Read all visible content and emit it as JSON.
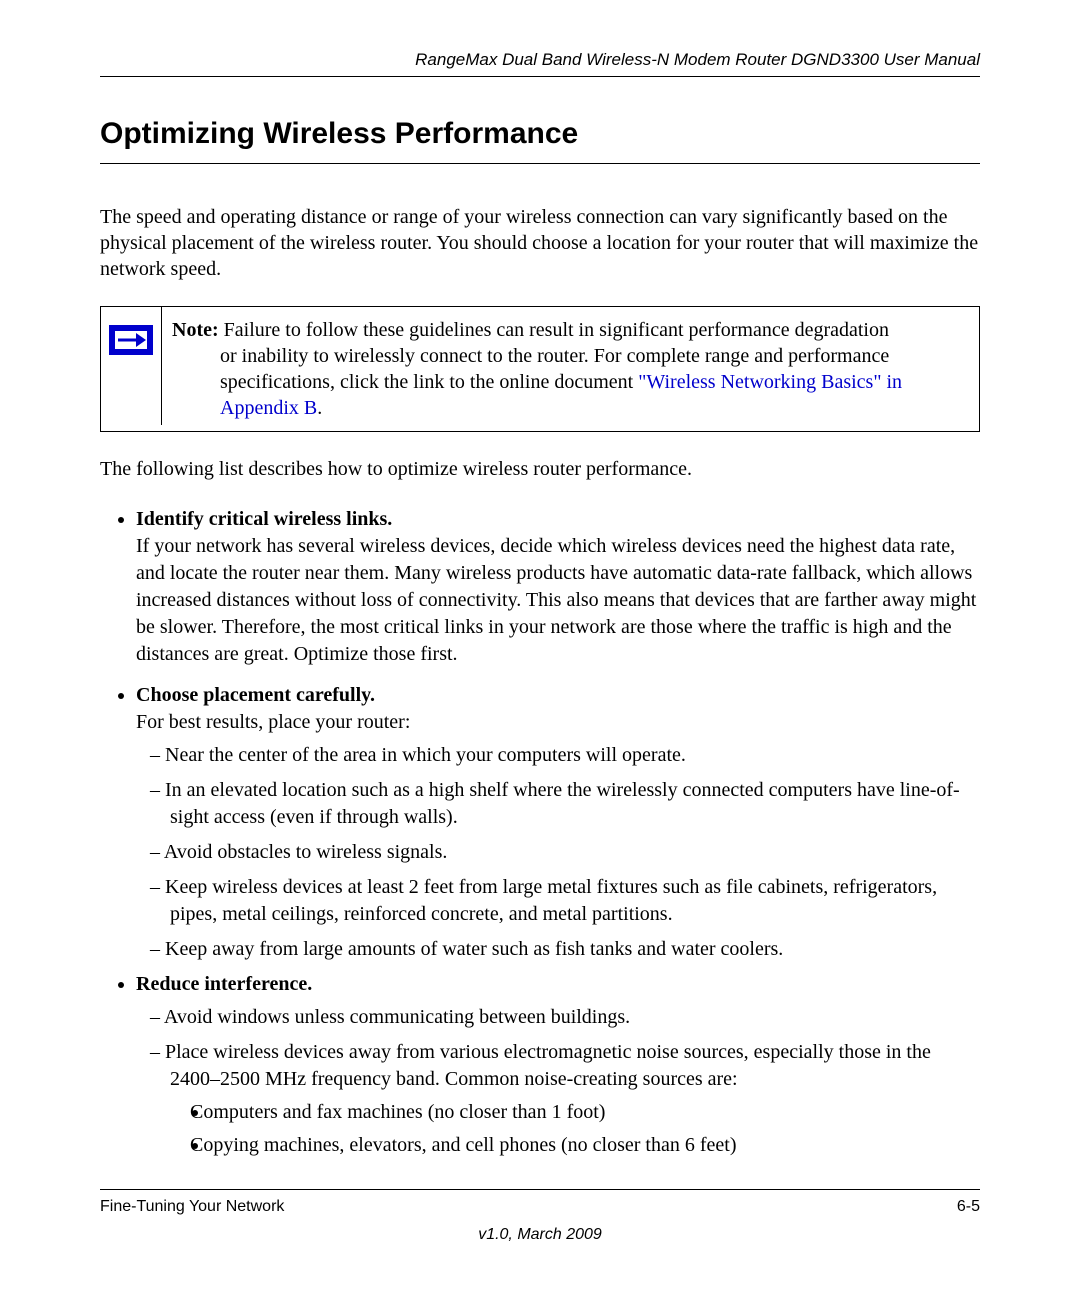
{
  "header": {
    "doc_title": "RangeMax Dual Band Wireless-N Modem Router DGND3300 User Manual"
  },
  "title": "Optimizing Wireless Performance",
  "intro": "The speed and operating distance or range of your wireless connection can vary significantly based on the physical placement of the wireless router. You should choose a location for your router that will maximize the network speed.",
  "note": {
    "label": "Note:",
    "text_before_link": " Failure to follow these guidelines can result in significant performance degradation or inability to wirelessly connect to the router. For complete range and performance specifications, click the link to the online document ",
    "link_text": "\"Wireless Networking Basics\" in Appendix B",
    "after_link": "."
  },
  "lead": "The following list describes how to optimize wireless router performance.",
  "b1": {
    "title": "Identify critical wireless links.",
    "body": "If your network has several wireless devices, decide which wireless devices need the highest data rate, and locate the router near them. Many wireless products have automatic data-rate fallback, which allows increased distances without loss of connectivity. This also means that devices that are farther away might be slower. Therefore, the most critical links in your network are those where the traffic is high and the distances are great. Optimize those first."
  },
  "b2": {
    "title": "Choose placement carefully.",
    "body": "For best results, place your router:",
    "d1": "Near the center of the area in which your computers will operate.",
    "d2": "In an elevated location such as a high shelf where the wirelessly connected computers have line-of-sight access (even if through walls).",
    "d3": "Avoid obstacles to wireless signals.",
    "d4": "Keep wireless devices at least 2 feet from large metal fixtures such as file cabinets, refrigerators, pipes, metal ceilings, reinforced concrete, and metal partitions.",
    "d5": "Keep away from large amounts of water such as fish tanks and water coolers."
  },
  "b3": {
    "title": "Reduce interference.",
    "d1": "Avoid windows unless communicating between buildings.",
    "d2": "Place wireless devices away from various electromagnetic noise sources, especially those in the 2400–2500 MHz frequency band. Common noise-creating sources are:",
    "s1": "Computers and fax machines (no closer than 1 foot)",
    "s2": "Copying machines, elevators, and cell phones (no closer than 6 feet)"
  },
  "footer": {
    "section": "Fine-Tuning Your Network",
    "page": "6-5",
    "version": "v1.0, March 2009"
  }
}
